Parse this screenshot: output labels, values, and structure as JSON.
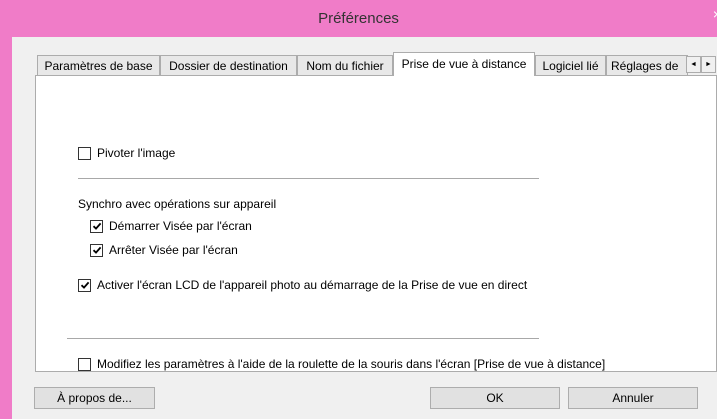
{
  "window": {
    "title": "Préférences",
    "close_glyph": "×"
  },
  "tabs": [
    "Paramètres de base",
    "Dossier de destination",
    "Nom du fichier",
    "Prise de vue à distance",
    "Logiciel lié",
    "Réglages de"
  ],
  "active_tab": "Prise de vue à distance",
  "tab_scroll": {
    "left_glyph": "◄",
    "right_glyph": "►"
  },
  "options": {
    "rotate": {
      "label": "Pivoter l'image",
      "checked": false
    },
    "sync_heading": "Synchro avec opérations sur appareil",
    "start_view": {
      "label": "Démarrer Visée par l'écran",
      "checked": true
    },
    "stop_view": {
      "label": "Arrêter Visée par l'écran",
      "checked": true
    },
    "enable_lcd": {
      "label": "Activer l'écran LCD de l'appareil photo au démarrage de la Prise de vue en direct",
      "checked": true
    },
    "mouse_wheel": {
      "label": "Modifiez les paramètres à l'aide de la roulette de la souris dans l'écran [Prise de vue à distance]",
      "checked": false
    }
  },
  "buttons": {
    "about": "À propos de...",
    "ok": "OK",
    "cancel": "Annuler"
  },
  "colors": {
    "title_bar": "#f07cc8",
    "dialog_bg": "#f0f0f0",
    "panel_bg": "#ffffff"
  }
}
